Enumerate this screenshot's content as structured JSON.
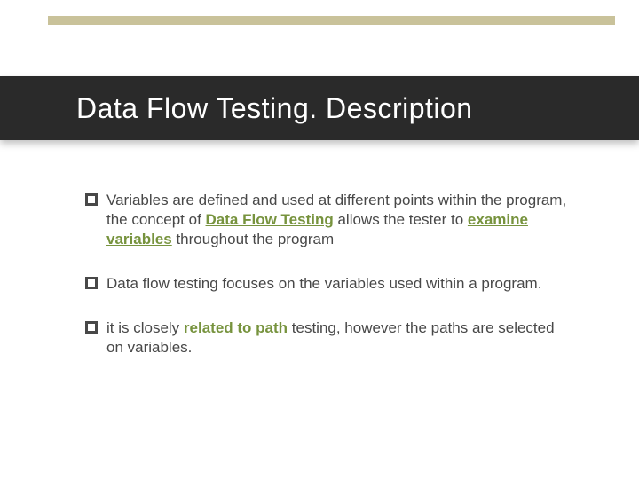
{
  "colors": {
    "accent": "#77933e",
    "stripe": "#c9c29a",
    "title_bg": "#2a2a2a"
  },
  "title": "Data Flow Testing. Description",
  "bullets": [
    {
      "pre1": "Variables are defined and used at different points within the program, the concept of ",
      "em1": "Data Flow Testing",
      "mid": " allows the tester to ",
      "em2": "examine variables",
      "post": " throughout the program",
      "justify": false
    },
    {
      "pre1": "Data flow testing focuses on the variables used within a program.",
      "em1": "",
      "mid": "",
      "em2": "",
      "post": "",
      "justify": true
    },
    {
      "pre1": "it is closely ",
      "em1": "related to path",
      "mid": " testing, however the paths are selected on variables.",
      "em2": "",
      "post": "",
      "justify": false
    }
  ]
}
